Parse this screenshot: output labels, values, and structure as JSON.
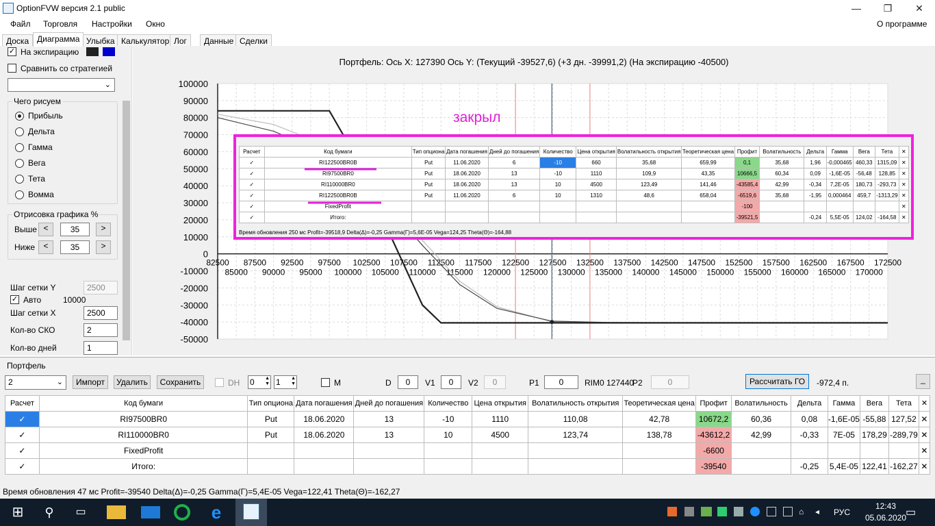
{
  "window": {
    "title": "OptionFVW версия 2.1 public",
    "minimize": "—",
    "maximize": "❐",
    "close": "✕"
  },
  "menu": {
    "file": "Файл",
    "trade": "Торговля",
    "settings": "Настройки",
    "window": "Окно",
    "about": "О программе"
  },
  "tabs": [
    "Доска",
    "Диаграмма",
    "Улыбка",
    "Калькулятор",
    "Лог",
    "Данные",
    "Сделки"
  ],
  "left": {
    "at_expiry": "На экспирацию",
    "compare": "Сравнить со стратегией",
    "what_draw": "Чего рисуем",
    "radios": [
      "Прибыль",
      "Дельта",
      "Гамма",
      "Вега",
      "Тета",
      "Вомма"
    ],
    "draw_pct": "Отрисовка графика %",
    "above_label": "Выше",
    "above_val": "35",
    "below_label": "Ниже",
    "below_val": "35",
    "grid_y_label": "Шаг сетки Y",
    "grid_y_val": "2500",
    "auto_label": "Авто",
    "auto_val": "10000",
    "grid_x_label": "Шаг сетки X",
    "grid_x_val": "2500",
    "sko_label": "Кол-во СКО",
    "sko_val": "2",
    "days_label": "Кол-во дней",
    "days_val": "1",
    "prev": "<",
    "next": ">"
  },
  "chart": {
    "header": "Портфель:  Ось X:  127390  Ось Y:   (Текущий -39527,6)   (+3 дн.  -39991,2)   (На экспирацию  -40500)",
    "annotation": "закрыл"
  },
  "chart_data": {
    "type": "line",
    "title": "Портфель:  Ось X:  127390  Ось Y:   (Текущий -39527,6)   (+3 дн.  -39991,2)   (На экспирацию  -40500)",
    "xlim": [
      82500,
      172500
    ],
    "ylim": [
      -50000,
      100000
    ],
    "y_ticks": [
      100000,
      90000,
      80000,
      70000,
      60000,
      50000,
      40000,
      30000,
      20000,
      10000,
      0,
      -10000,
      -20000,
      -30000,
      -40000,
      -50000
    ],
    "x_ticks_upper": [
      82500,
      87500,
      92500,
      97500,
      102500,
      107500,
      112500,
      117500,
      122500,
      127500,
      132500,
      137500,
      142500,
      147500,
      152500,
      157500,
      162500,
      167500,
      172500
    ],
    "x_ticks_lower": [
      85000,
      90000,
      95000,
      100000,
      105000,
      110000,
      115000,
      120000,
      125000,
      130000,
      135000,
      140000,
      145000,
      150000,
      155000,
      160000,
      165000,
      170000
    ],
    "current_x": 127390,
    "vlines_red": [
      122500,
      132500
    ],
    "series": [
      {
        "x": [
          82500,
          97500,
          100000,
          110000,
          112500,
          172500
        ],
        "y": [
          84000,
          84000,
          65000,
          -30000,
          -40500,
          -40500
        ],
        "color": "#222222"
      },
      {
        "x": [
          82500,
          90000,
          97500,
          105000,
          110000,
          115000,
          120000,
          127390,
          135000,
          150000,
          172500
        ],
        "y": [
          80000,
          72000,
          58000,
          30000,
          5000,
          -18000,
          -32000,
          -39500,
          -40300,
          -40500,
          -40500
        ],
        "color": "#444444"
      },
      {
        "x": [
          82500,
          90000,
          97500,
          105000,
          110000,
          115000,
          120000,
          127390,
          135000,
          150000,
          172500
        ],
        "y": [
          82000,
          76000,
          63000,
          34000,
          8000,
          -16000,
          -31000,
          -39900,
          -40400,
          -40500,
          -40500
        ],
        "color": "#bbbbbb"
      }
    ]
  },
  "overlay": {
    "headers": [
      "Расчет",
      "Код бумаги",
      "Тип опциона",
      "Дата погашения",
      "Дней до погашения",
      "Количество",
      "Цена открытия",
      "Волатильность открытия",
      "Теоретическая цена",
      "Профит",
      "Волатильность",
      "Дельта",
      "Гамма",
      "Вега",
      "Тета",
      "✕"
    ],
    "rows": [
      [
        "✓",
        "RI122500BR0B",
        "Put",
        "11.06.2020",
        "6",
        "-10",
        "660",
        "35,68",
        "659,99",
        "0,1",
        "35,68",
        "1,96",
        "-0,000465",
        "460,33",
        "1315,09",
        "✕"
      ],
      [
        "✓",
        "RI97500BR0",
        "Put",
        "18.06.2020",
        "13",
        "-10",
        "1110",
        "109,9",
        "43,35",
        "10666,5",
        "60,34",
        "0,09",
        "-1,6E-05",
        "-56,48",
        "128,85",
        "✕"
      ],
      [
        "✓",
        "RI110000BR0",
        "Put",
        "18.06.2020",
        "13",
        "10",
        "4500",
        "123,49",
        "141,46",
        "-43585,4",
        "42,99",
        "-0,34",
        "7,2E-05",
        "180,73",
        "-293,73",
        "✕"
      ],
      [
        "✓",
        "RI122500BR0B",
        "Put",
        "11.06.2020",
        "6",
        "10",
        "1310",
        "48,6",
        "658,04",
        "-6519,6",
        "35,68",
        "-1,95",
        "0,000464",
        "459,7",
        "-1313,29",
        "✕"
      ],
      [
        "✓",
        "FixedProfit",
        "",
        "",
        "",
        "",
        "",
        "",
        "",
        "-100",
        "",
        "",
        "",
        "",
        "",
        "✕"
      ],
      [
        "✓",
        "Итого:",
        "",
        "",
        "",
        "",
        "",
        "",
        "",
        "-39521,5",
        "",
        "-0,24",
        "5,5E-05",
        "124,02",
        "-164,58",
        "✕"
      ]
    ],
    "status": "Время обновления 250 мс  Profit=-39518,9 Delta(Δ)=-0,25 Gamma(Γ)=5,6E-05 Vega=124,25 Theta(Θ)=-164,88"
  },
  "portfolio": {
    "label": "Портфель",
    "select_val": "2",
    "import": "Импорт",
    "delete": "Удалить",
    "save": "Сохранить",
    "dh": "DH",
    "spin1": "0",
    "spin2": "1",
    "m": "M",
    "d_label": "D",
    "d_val": "0",
    "v1_label": "V1",
    "v1_val": "0",
    "v2_label": "V2",
    "v2_val": "0",
    "p1_label": "P1",
    "p1_val": "0",
    "rim_text": "RIM0 127440",
    "p2_label": "P2",
    "p2_val": "0",
    "calc_go": "Рассчитать ГО",
    "go_val": "-972,4 п.",
    "small_btn": "_"
  },
  "table": {
    "headers": [
      "Расчет",
      "Код бумаги",
      "Тип опциона",
      "Дата погашения",
      "Дней до погашения",
      "Количество",
      "Цена открытия",
      "Волатильность открытия",
      "Теоретическая цена",
      "Профит",
      "Волатильность",
      "Дельта",
      "Гамма",
      "Вега",
      "Тета",
      "✕"
    ],
    "rows": [
      [
        "✓",
        "RI97500BR0",
        "Put",
        "18.06.2020",
        "13",
        "-10",
        "1110",
        "110,08",
        "42,78",
        "10672,2",
        "60,36",
        "0,08",
        "-1,6E-05",
        "-55,88",
        "127,52",
        "✕"
      ],
      [
        "✓",
        "RI110000BR0",
        "Put",
        "18.06.2020",
        "13",
        "10",
        "4500",
        "123,74",
        "138,78",
        "-43612,2",
        "42,99",
        "-0,33",
        "7E-05",
        "178,29",
        "-289,79",
        "✕"
      ],
      [
        "✓",
        "FixedProfit",
        "",
        "",
        "",
        "",
        "",
        "",
        "",
        "-6600",
        "",
        "",
        "",
        "",
        "",
        "✕"
      ],
      [
        "✓",
        "Итого:",
        "",
        "",
        "",
        "",
        "",
        "",
        "",
        "-39540",
        "",
        "-0,25",
        "5,4E-05",
        "122,41",
        "-162,27",
        "✕"
      ]
    ]
  },
  "status": "Время обновления 47 мс  Profit=-39540 Delta(Δ)=-0,25 Gamma(Γ)=5,4E-05 Vega=122,41 Theta(Θ)=-162,27",
  "taskbar": {
    "time": "12:43",
    "date": "05.06.2020",
    "lang": "РУС"
  }
}
